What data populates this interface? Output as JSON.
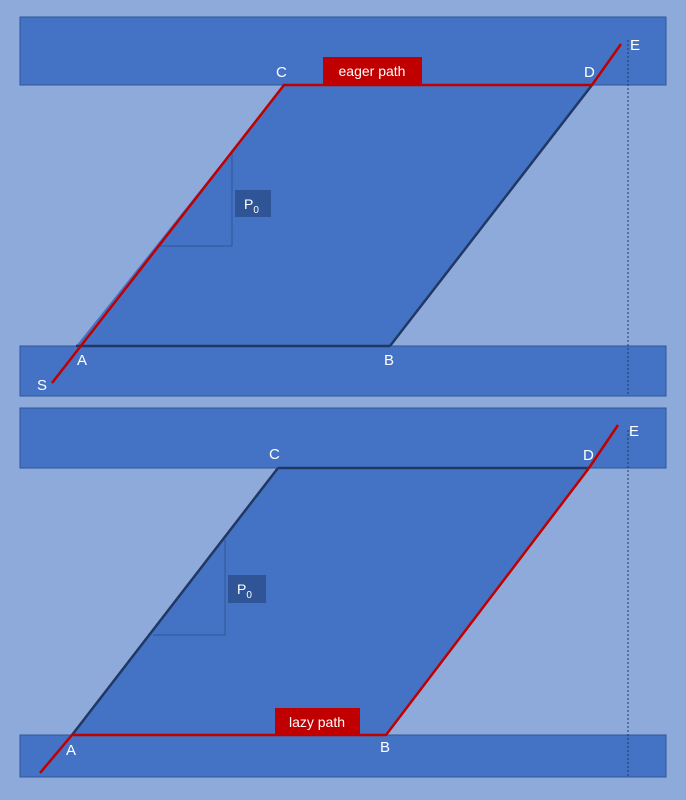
{
  "colors": {
    "background": "#8eaadb",
    "band": "#4472c4",
    "band_stroke": "#2f5597",
    "parallelogram": "#4472c4",
    "edge": "#203864",
    "path": "#c00000",
    "p0_box": "#2f5597",
    "text": "#ffffff",
    "guide": "#203864"
  },
  "panels": [
    {
      "id": "eager",
      "points": {
        "S": "S",
        "A": "A",
        "B": "B",
        "C": "C",
        "D": "D",
        "E": "E"
      },
      "path_label": "eager path",
      "p0": {
        "base": "P",
        "sub": "0"
      }
    },
    {
      "id": "lazy",
      "points": {
        "A": "A",
        "B": "B",
        "C": "C",
        "D": "D",
        "E": "E"
      },
      "path_label": "lazy path",
      "p0": {
        "base": "P",
        "sub": "0"
      }
    }
  ]
}
